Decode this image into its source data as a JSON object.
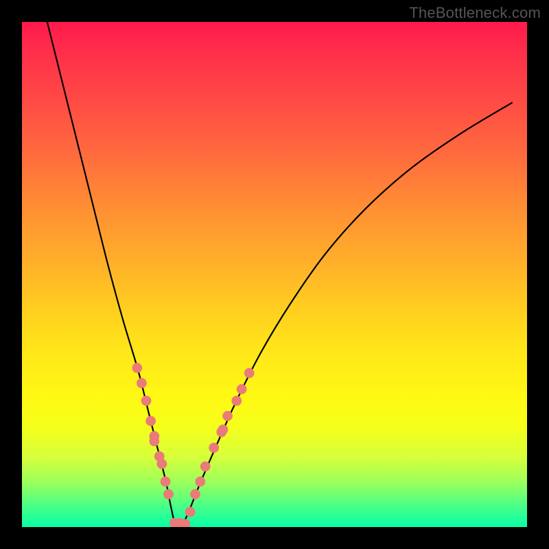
{
  "watermark": "TheBottleneck.com",
  "chart_data": {
    "type": "line",
    "title": "",
    "xlabel": "",
    "ylabel": "",
    "xlim": [
      0,
      100
    ],
    "ylim": [
      0,
      100
    ],
    "series": [
      {
        "name": "bottleneck-curve",
        "x": [
          5,
          8,
          11,
          14,
          17,
          20,
          23,
          25,
          27,
          28.5,
          29.5,
          30.5,
          31.5,
          33,
          35,
          38,
          42,
          47,
          53,
          60,
          68,
          77,
          87,
          97
        ],
        "y": [
          100,
          88,
          76,
          64,
          52,
          41,
          31,
          23,
          15,
          9,
          4,
          0,
          0,
          3,
          8,
          15,
          24,
          34,
          44,
          54,
          63,
          71,
          78,
          84
        ]
      }
    ],
    "markers": {
      "name": "sample-points",
      "color": "#e97b78",
      "radius_pct": 1.0,
      "points": [
        {
          "x": 22.8,
          "y": 31.5
        },
        {
          "x": 23.7,
          "y": 28.5
        },
        {
          "x": 24.6,
          "y": 25.0
        },
        {
          "x": 25.5,
          "y": 21.0
        },
        {
          "x": 26.2,
          "y": 18.0
        },
        {
          "x": 26.2,
          "y": 17.0
        },
        {
          "x": 27.2,
          "y": 14.0
        },
        {
          "x": 27.7,
          "y": 12.5
        },
        {
          "x": 28.4,
          "y": 9.0
        },
        {
          "x": 29.0,
          "y": 6.5
        },
        {
          "x": 30.2,
          "y": 0.8
        },
        {
          "x": 31.3,
          "y": 0.8
        },
        {
          "x": 32.3,
          "y": 0.6
        },
        {
          "x": 33.3,
          "y": 3.0
        },
        {
          "x": 34.3,
          "y": 6.5
        },
        {
          "x": 35.3,
          "y": 9.0
        },
        {
          "x": 36.3,
          "y": 12.0
        },
        {
          "x": 38.0,
          "y": 15.7
        },
        {
          "x": 39.5,
          "y": 18.8
        },
        {
          "x": 39.8,
          "y": 19.3
        },
        {
          "x": 40.7,
          "y": 22.0
        },
        {
          "x": 42.5,
          "y": 25.0
        },
        {
          "x": 43.5,
          "y": 27.3
        },
        {
          "x": 45.0,
          "y": 30.5
        }
      ]
    }
  }
}
